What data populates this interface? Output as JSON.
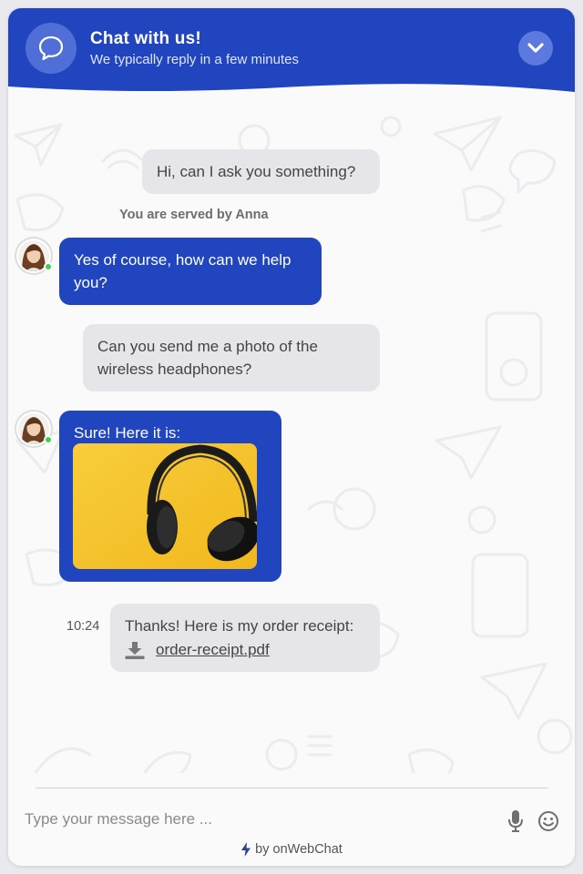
{
  "header": {
    "title": "Chat with us!",
    "subtitle": "We typically reply in a few minutes",
    "avatar_icon": "chat-bubble-icon",
    "collapse_icon": "chevron-down-icon",
    "brand_color": "#2145be"
  },
  "messages": [
    {
      "from": "user",
      "text": "Hi, can I ask you something?"
    },
    {
      "from": "system",
      "text": "You are served by Anna"
    },
    {
      "from": "agent",
      "text": "Yes of course, how can we help you?"
    },
    {
      "from": "user",
      "text": "Can you send me a photo of the wireless headphones?"
    },
    {
      "from": "agent",
      "text": "Sure! Here it is:",
      "attachment": "headphones-photo"
    },
    {
      "from": "user",
      "time": "10:24",
      "text": "Thanks! Here is my order receipt:",
      "file": "order-receipt.pdf",
      "file_icon": "download-icon"
    }
  ],
  "composer": {
    "placeholder": "Type your message here ...",
    "mic_icon": "microphone-icon",
    "emoji_icon": "smiley-icon"
  },
  "footer": {
    "branding": "by onWebChat",
    "branding_icon": "lightning-icon"
  }
}
